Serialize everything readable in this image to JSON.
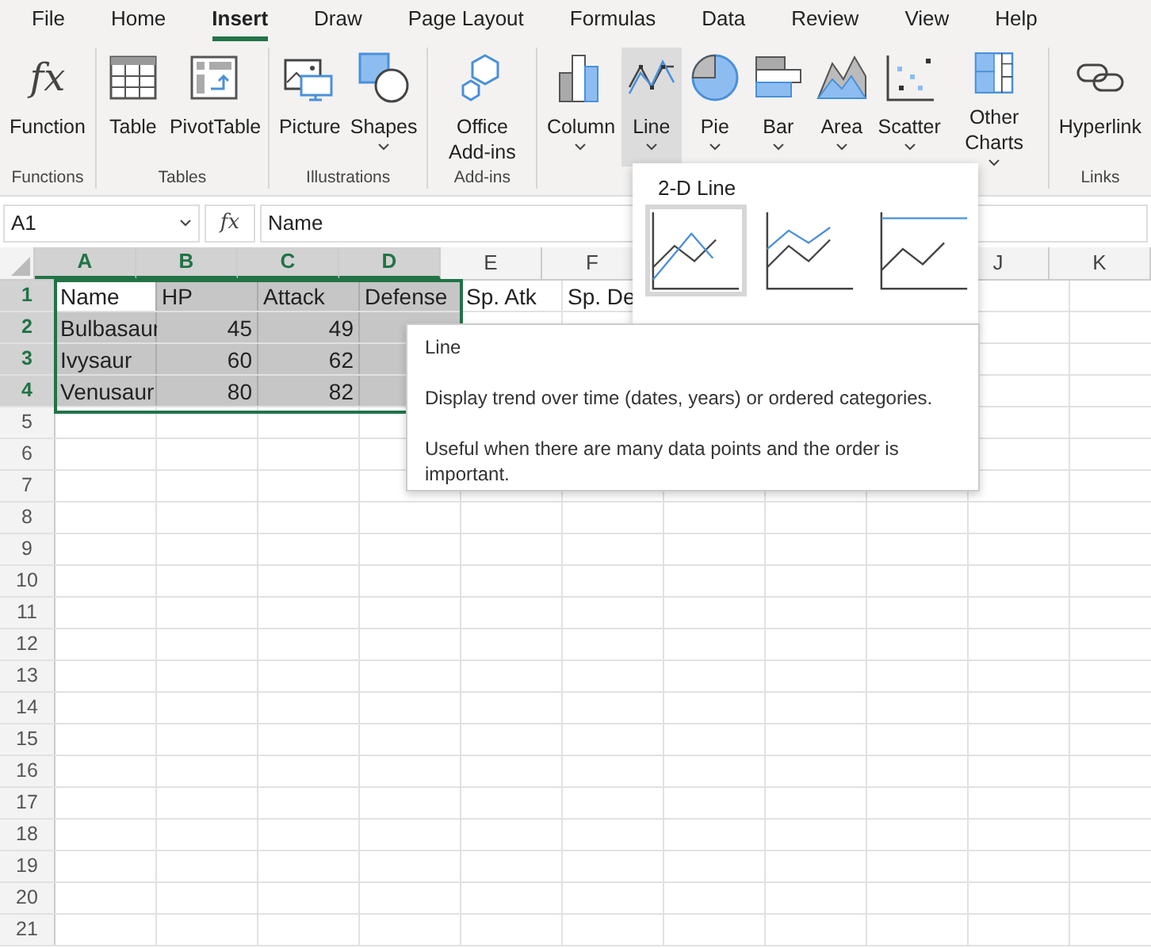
{
  "menu_tabs": [
    {
      "label": "File",
      "selected": false
    },
    {
      "label": "Home",
      "selected": false
    },
    {
      "label": "Insert",
      "selected": true
    },
    {
      "label": "Draw",
      "selected": false
    },
    {
      "label": "Page Layout",
      "selected": false
    },
    {
      "label": "Formulas",
      "selected": false
    },
    {
      "label": "Data",
      "selected": false
    },
    {
      "label": "Review",
      "selected": false
    },
    {
      "label": "View",
      "selected": false
    },
    {
      "label": "Help",
      "selected": false
    }
  ],
  "ribbon_groups": [
    {
      "label": "Functions",
      "buttons": [
        {
          "kind": "function",
          "glyph": "fx",
          "label": "Function",
          "dropdown": false,
          "pressed": false
        }
      ]
    },
    {
      "label": "Tables",
      "buttons": [
        {
          "kind": "table",
          "label": "Table",
          "dropdown": false,
          "pressed": false
        },
        {
          "kind": "pivot",
          "label": "PivotTable",
          "dropdown": false,
          "pressed": false
        }
      ]
    },
    {
      "label": "Illustrations",
      "buttons": [
        {
          "kind": "picture",
          "label": "Picture",
          "dropdown": false,
          "pressed": false
        },
        {
          "kind": "shapes",
          "label": "Shapes",
          "dropdown": true,
          "pressed": false
        }
      ]
    },
    {
      "label": "Add-ins",
      "buttons": [
        {
          "kind": "addins",
          "label": "Office Add-ins",
          "dropdown": false,
          "pressed": false
        }
      ]
    },
    {
      "buttons": [
        {
          "kind": "column",
          "label": "Column",
          "dropdown": true,
          "pressed": false
        },
        {
          "kind": "line",
          "label": "Line",
          "dropdown": true,
          "pressed": true
        },
        {
          "kind": "pie",
          "label": "Pie",
          "dropdown": true,
          "pressed": false
        },
        {
          "kind": "bar",
          "label": "Bar",
          "dropdown": true,
          "pressed": false
        },
        {
          "kind": "area",
          "label": "Area",
          "dropdown": true,
          "pressed": false
        },
        {
          "kind": "scatter",
          "label": "Scatter",
          "dropdown": true,
          "pressed": false
        },
        {
          "kind": "other",
          "label": "Other Charts",
          "dropdown": true,
          "pressed": false
        }
      ]
    },
    {
      "label": "Links",
      "buttons": [
        {
          "kind": "hyperlink",
          "label": "Hyperlink",
          "dropdown": false,
          "pressed": false
        }
      ]
    }
  ],
  "formula_bar": {
    "name_box": "A1",
    "fx": "fx",
    "value": "Name"
  },
  "columns": [
    {
      "label": "A",
      "selected": true
    },
    {
      "label": "B",
      "selected": true
    },
    {
      "label": "C",
      "selected": true
    },
    {
      "label": "D",
      "selected": true
    },
    {
      "label": "E",
      "selected": false
    },
    {
      "label": "F",
      "selected": false
    },
    {
      "label": "J",
      "selected": false
    },
    {
      "label": "K",
      "selected": false
    }
  ],
  "rows": [
    {
      "label": "1",
      "selected": true,
      "cells": [
        {
          "text": "Name",
          "kind": "text",
          "active": true
        },
        {
          "text": "HP",
          "kind": "text"
        },
        {
          "text": "Attack",
          "kind": "text"
        },
        {
          "text": "Defense",
          "kind": "text"
        },
        {
          "text": "Sp. Atk",
          "kind": "text"
        },
        {
          "text": "Sp. De",
          "kind": "text"
        }
      ]
    },
    {
      "label": "2",
      "selected": true,
      "cells": [
        {
          "text": "Bulbasaur",
          "kind": "text"
        },
        {
          "text": "45",
          "kind": "number"
        },
        {
          "text": "49",
          "kind": "number"
        }
      ]
    },
    {
      "label": "3",
      "selected": true,
      "cells": [
        {
          "text": "Ivysaur",
          "kind": "text"
        },
        {
          "text": "60",
          "kind": "number"
        },
        {
          "text": "62",
          "kind": "number"
        }
      ]
    },
    {
      "label": "4",
      "selected": true,
      "cells": [
        {
          "text": "Venusaur",
          "kind": "text"
        },
        {
          "text": "80",
          "kind": "number"
        },
        {
          "text": "82",
          "kind": "number"
        }
      ]
    },
    {
      "label": "5",
      "selected": false
    },
    {
      "label": "6",
      "selected": false
    },
    {
      "label": "7",
      "selected": false
    },
    {
      "label": "8",
      "selected": false
    },
    {
      "label": "9",
      "selected": false
    },
    {
      "label": "10",
      "selected": false
    },
    {
      "label": "11",
      "selected": false
    },
    {
      "label": "12",
      "selected": false
    },
    {
      "label": "13",
      "selected": false
    },
    {
      "label": "14",
      "selected": false
    },
    {
      "label": "15",
      "selected": false
    },
    {
      "label": "16",
      "selected": false
    },
    {
      "label": "17",
      "selected": false
    },
    {
      "label": "18",
      "selected": false
    },
    {
      "label": "19",
      "selected": false
    },
    {
      "label": "20",
      "selected": false
    },
    {
      "label": "21",
      "selected": false
    }
  ],
  "chart_dropdown": {
    "heading": "2-D Line",
    "options": [
      {
        "kind": "line",
        "selected": true
      },
      {
        "kind": "stacked_line",
        "selected": false
      },
      {
        "kind": "percent_line",
        "selected": false
      }
    ]
  },
  "tooltip": {
    "title": "Line",
    "paragraphs": [
      "Display trend over time (dates, years) or ordered categories.",
      "Useful when there are many data points and the order is important."
    ]
  }
}
